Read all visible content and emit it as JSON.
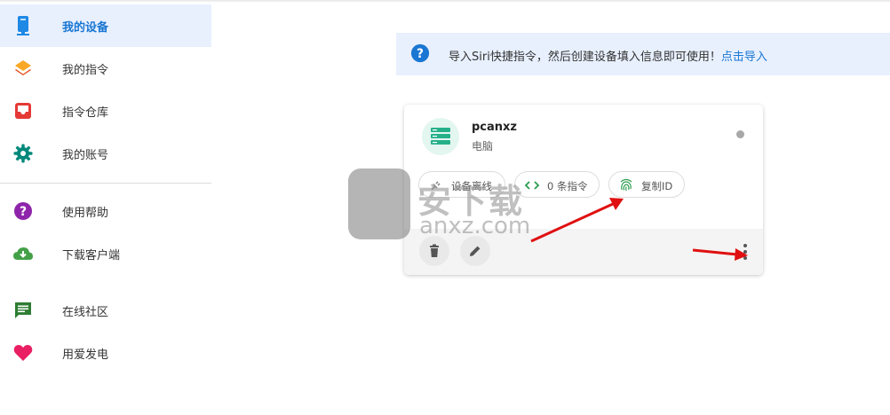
{
  "sidebar": {
    "items": [
      {
        "label": "我的设备",
        "icon": "phone-device-icon",
        "active": true
      },
      {
        "label": "我的指令",
        "icon": "layers-icon"
      },
      {
        "label": "指令仓库",
        "icon": "inbox-icon"
      },
      {
        "label": "我的账号",
        "icon": "gear-icon"
      },
      {
        "label": "使用帮助",
        "icon": "help-circle-icon"
      },
      {
        "label": "下载客户端",
        "icon": "cloud-download-icon"
      },
      {
        "label": "在线社区",
        "icon": "chat-icon"
      },
      {
        "label": "用爱发电",
        "icon": "heart-icon"
      }
    ]
  },
  "banner": {
    "text": "导入Siri快捷指令，然后创建设备填入信息即可使用！",
    "link": "点击导入"
  },
  "device": {
    "name": "pcanxz",
    "type": "电脑",
    "status_color": "#a8a8a8",
    "chips": {
      "offline": "设备离线",
      "commands": "0 条指令",
      "copy_id": "复制ID"
    }
  },
  "watermark": {
    "main": "安下载",
    "sub": "anxz.com"
  },
  "colors": {
    "accent": "#1976d2",
    "active_bg": "#e8f0fe",
    "device_icon": "#26b08a",
    "arrow": "#e01010"
  }
}
